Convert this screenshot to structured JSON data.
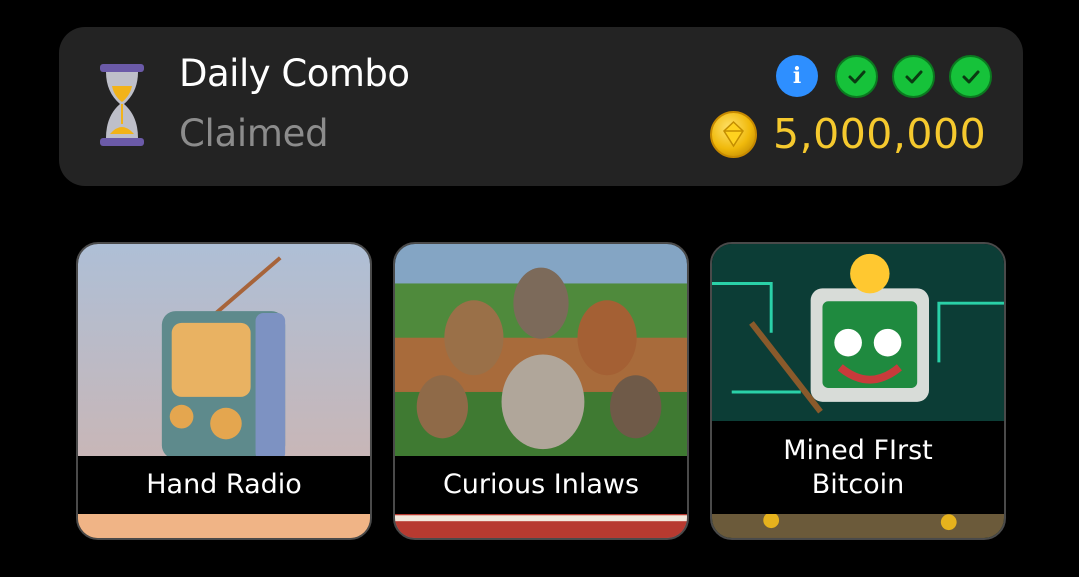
{
  "combo": {
    "title": "Daily Combo",
    "status": "Claimed",
    "reward": "5,000,000",
    "progress_found": 3,
    "progress_total": 3
  },
  "icons": {
    "timer": "hourglass-icon",
    "info": "info-icon",
    "check": "checkmark-icon",
    "coin": "coin-icon"
  },
  "colors": {
    "panel": "#232323",
    "reward_text": "#f5c92e",
    "check": "#16c23a",
    "info": "#2e8fff",
    "status_text": "#8c8c8c"
  },
  "cards": [
    {
      "label": "Hand Radio"
    },
    {
      "label": "Curious Inlaws"
    },
    {
      "label": "Mined FIrst\nBitcoin"
    }
  ]
}
